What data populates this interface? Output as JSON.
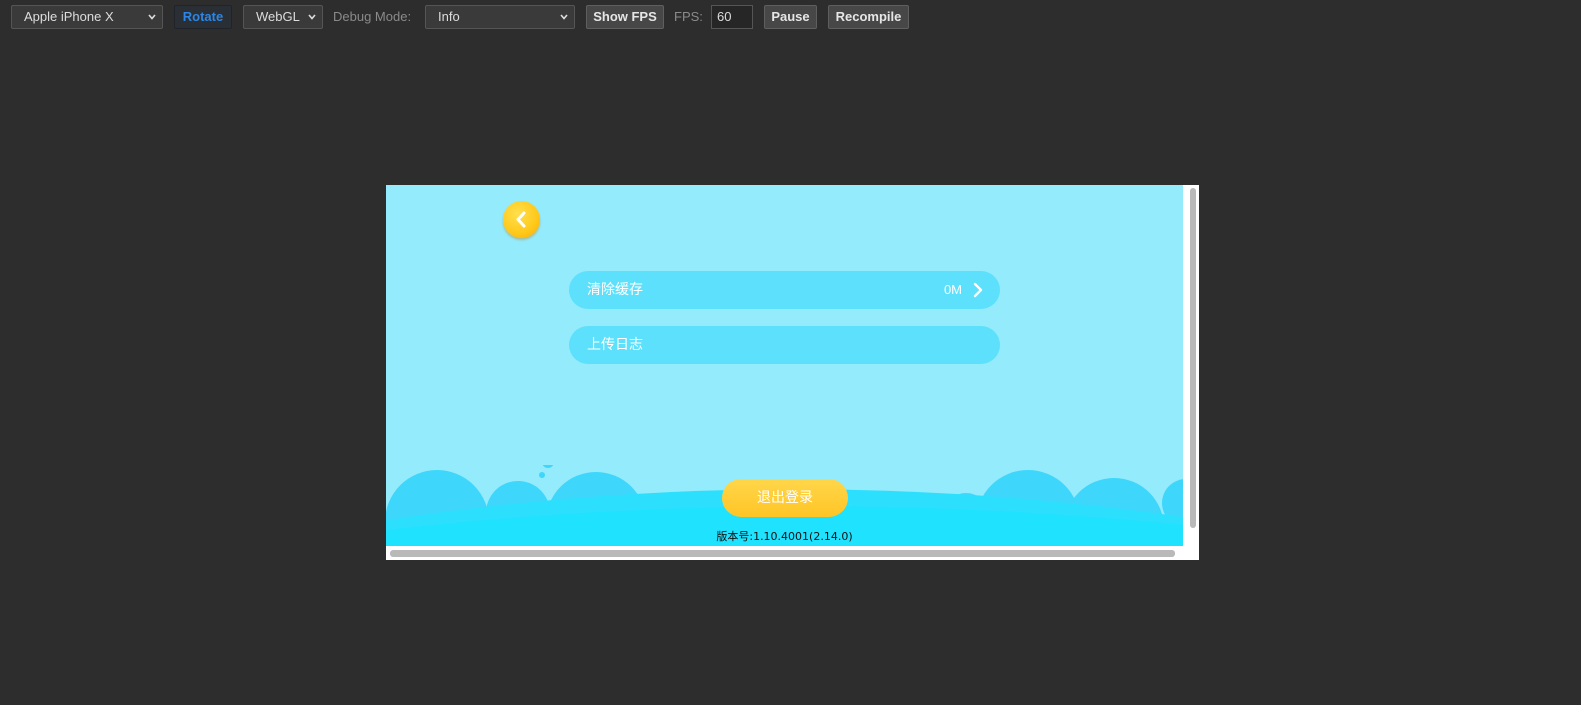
{
  "toolbar": {
    "device_select": "Apple iPhone X",
    "rotate_label": "Rotate",
    "renderer_select": "WebGL",
    "debug_mode_label": "Debug Mode:",
    "debug_mode_select": "Info",
    "show_fps_label": "Show FPS",
    "fps_label": "FPS:",
    "fps_value": "60",
    "pause_label": "Pause",
    "recompile_label": "Recompile"
  },
  "game": {
    "back_icon": "chevron-left-icon",
    "rows": [
      {
        "label": "清除缓存",
        "value": "0M",
        "icon": "chevron-right-icon"
      },
      {
        "label": "上传日志"
      }
    ],
    "logout_label": "退出登录",
    "version_text": "版本号:1.10.4001(2.14.0)"
  },
  "colors": {
    "background": "#2d2d2d",
    "screen": "#93ebfc",
    "row": "#5de0fb",
    "button_yellow": "#ffc526",
    "active_text": "#2b86e6"
  }
}
